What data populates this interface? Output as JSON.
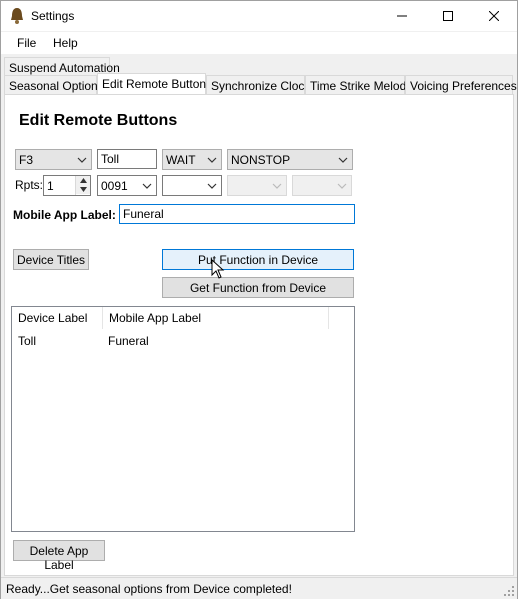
{
  "window": {
    "title": "Settings",
    "icon": "bell-icon"
  },
  "menu": {
    "items": [
      "File",
      "Help"
    ]
  },
  "tabs": {
    "row1": [
      "Suspend Automation"
    ],
    "row2": [
      "Seasonal Options",
      "Edit Remote Buttons",
      "Synchronize Clock",
      "Time Strike Melody",
      "Voicing Preferences"
    ],
    "active": "Edit Remote Buttons"
  },
  "panel": {
    "heading": "Edit Remote Buttons",
    "row1": {
      "button_select": "F3",
      "name_value": "Toll",
      "action_select": "WAIT",
      "mode_select": "NONSTOP"
    },
    "row2": {
      "rpts_label": "Rpts:",
      "rpts_value": "1",
      "code_select": "0091",
      "select3": "",
      "select4": "",
      "select5": ""
    },
    "mobile_label": "Mobile App Label:",
    "mobile_value": "Funeral",
    "buttons": {
      "device_titles": "Device Titles",
      "put_function": "Put Function in Device",
      "get_function": "Get Function from Device",
      "delete_label": "Delete App Label"
    },
    "list": {
      "columns": [
        "Device Label",
        "Mobile App Label"
      ],
      "rows": [
        {
          "device_label": "Toll",
          "mobile_label": "Funeral"
        }
      ]
    }
  },
  "status": {
    "text": "Ready...Get seasonal options from Device completed!"
  }
}
